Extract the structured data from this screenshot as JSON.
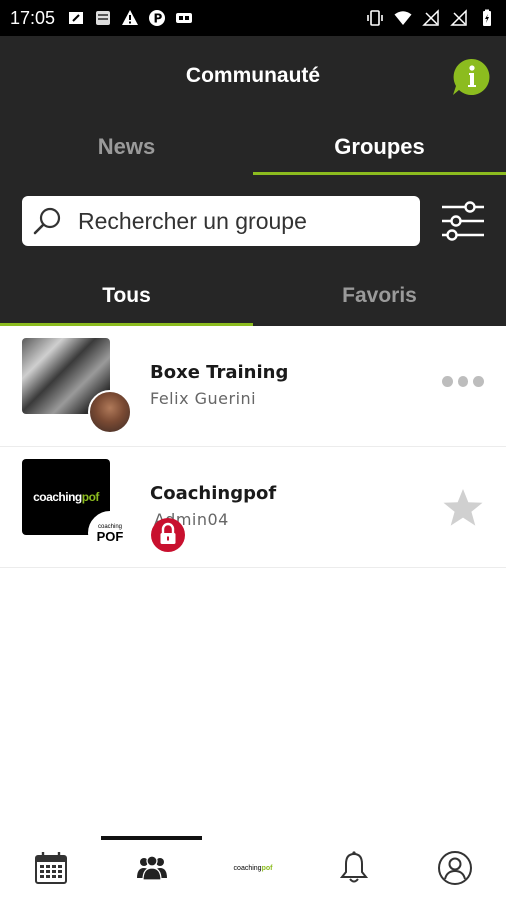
{
  "status_bar": {
    "time": "17:05",
    "left_icons": [
      "edit-note-icon",
      "news-icon",
      "warning-icon",
      "parking-icon",
      "sim-icon"
    ],
    "right_icons": [
      "vibrate-icon",
      "wifi-icon",
      "no-signal-icon",
      "no-signal-icon",
      "battery-icon"
    ]
  },
  "header": {
    "title": "Communauté",
    "info_icon": "info-icon",
    "accent_color": "#8cbc1f",
    "background_color": "#262626"
  },
  "main_tabs": [
    {
      "label": "News",
      "active": false
    },
    {
      "label": "Groupes",
      "active": true
    }
  ],
  "search": {
    "placeholder": "Rechercher un groupe",
    "value": "",
    "filter_icon": "sliders-icon"
  },
  "sub_tabs": [
    {
      "label": "Tous",
      "active": true
    },
    {
      "label": "Favoris",
      "active": false
    }
  ],
  "groups": [
    {
      "name": "Boxe Training",
      "admin": "Felix Guerini",
      "action_icon": "more-dots-icon",
      "locked": false
    },
    {
      "name": "Coachingpof",
      "admin": "Admin04",
      "action_icon": "star-icon",
      "locked": true,
      "lock_color": "#c8102e",
      "logo_text": "coachingpof",
      "avatar_text_small": "coaching",
      "avatar_text_big": "POF"
    }
  ],
  "bottom_nav": [
    {
      "name": "calendar",
      "icon": "calendar-icon",
      "active": false
    },
    {
      "name": "groups",
      "icon": "group-icon",
      "active": true
    },
    {
      "name": "home",
      "icon": "coachingpof-logo",
      "logo_text": "coachingpof",
      "active": false
    },
    {
      "name": "notifications",
      "icon": "bell-icon",
      "active": false
    },
    {
      "name": "profile",
      "icon": "profile-icon",
      "active": false
    }
  ]
}
